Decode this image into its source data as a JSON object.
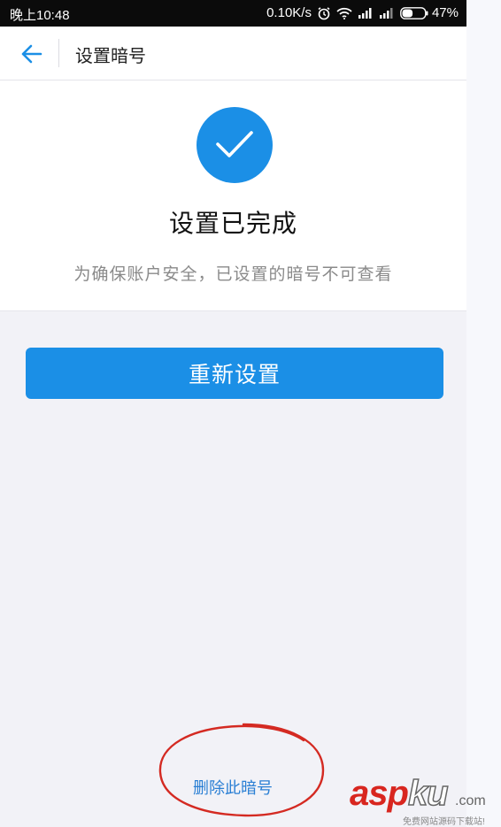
{
  "status_bar": {
    "time": "晚上10:48",
    "net_speed": "0.10K/s",
    "battery_percent": "47%",
    "battery_level": 0.47,
    "icons": [
      "alarm-icon",
      "wifi-icon",
      "signal-icon",
      "signal-icon",
      "battery-icon"
    ]
  },
  "header": {
    "back_icon": "arrow-left-icon",
    "title": "设置暗号"
  },
  "result": {
    "icon": "checkmark-icon",
    "title": "设置已完成",
    "hint": "为确保账户安全，已设置的暗号不可查看"
  },
  "actions": {
    "reset_label": "重新设置",
    "delete_label": "删除此暗号"
  },
  "watermark": {
    "asp": "asp",
    "ku": "ku",
    "com": ".com",
    "tagline": "免费网站源码下载站!"
  },
  "colors": {
    "accent": "#1b8fe6",
    "link": "#2a7fd4",
    "annotation": "#d42a22"
  }
}
